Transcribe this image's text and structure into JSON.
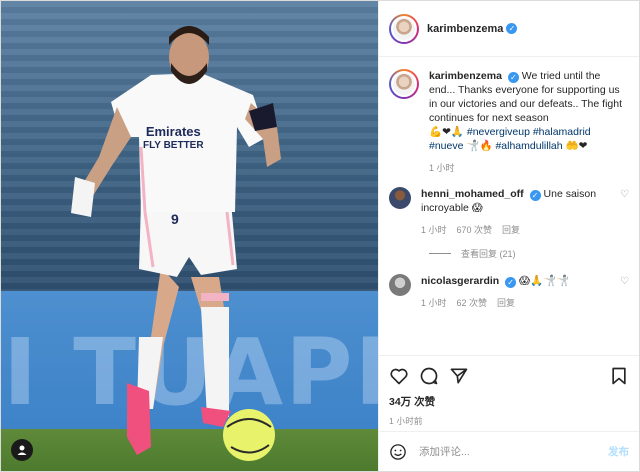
{
  "photo": {
    "board_text": "I TUAPP",
    "jersey_number": "9",
    "sponsor_line1": "Emirates",
    "sponsor_line2": "FLY BETTER"
  },
  "header": {
    "username": "karimbenzema",
    "verified": true
  },
  "caption": {
    "username": "karimbenzema",
    "text": "We tried until the end... Thanks everyone for supporting us in our victories and our defeats.. The fight continues for next season",
    "emoji_line": "💪❤🙏",
    "hashtag_1": "#nevergiveup",
    "hashtag_2": "#halamadrid",
    "hashtag_3": "#nueve",
    "emoji_mid": "🤺🔥",
    "hashtag_4": "#alhamdulillah",
    "emoji_end": "🤲❤",
    "time": "1 小时"
  },
  "comments": [
    {
      "username": "henni_mohamed_off",
      "verified": true,
      "text": "Une saison incroyable 😱",
      "time": "1 小时",
      "likes": "670 次赞",
      "reply": "回复"
    },
    {
      "username": "nicolasgerardin",
      "verified": true,
      "text": "😱🙏🤺🤺",
      "time": "1 小时",
      "likes": "62 次赞",
      "reply": "回复"
    }
  ],
  "view_replies": "查看回复 (21)",
  "likes_count": "34万 次赞",
  "post_time": "1 小时前",
  "add_comment_placeholder": "添加评论...",
  "post_button": "发布",
  "colors": {
    "link": "#00376b",
    "verified": "#3897f0",
    "muted": "#8e8e8e",
    "post_button": "#b2dffc"
  }
}
